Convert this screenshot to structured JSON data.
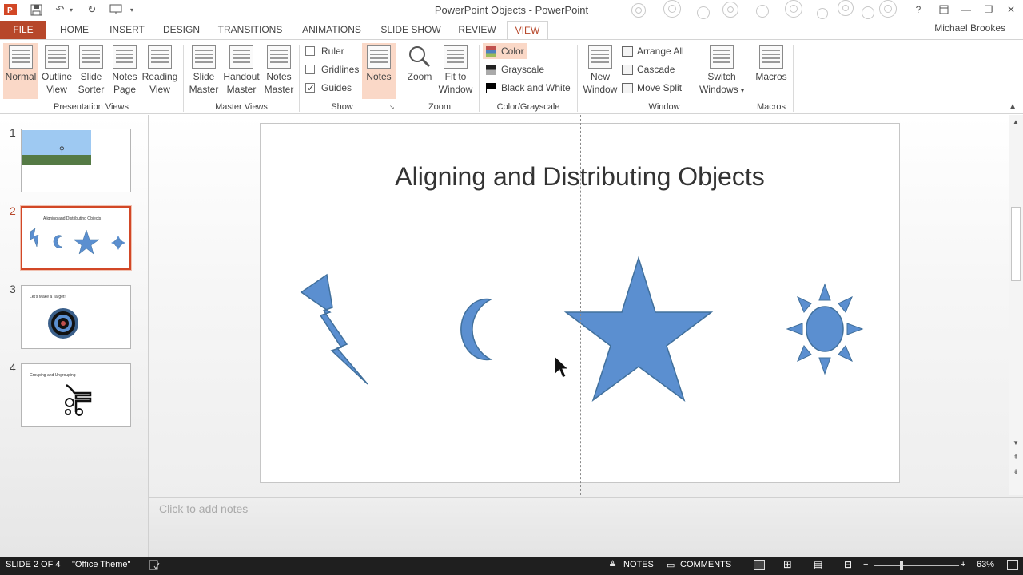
{
  "titlebar": {
    "app_title": "PowerPoint Objects - PowerPoint",
    "help": "?",
    "minimize": "—",
    "restore": "❐",
    "close": "✕"
  },
  "tabs": {
    "file": "FILE",
    "home": "HOME",
    "insert": "INSERT",
    "design": "DESIGN",
    "transitions": "TRANSITIONS",
    "animations": "ANIMATIONS",
    "slideshow": "SLIDE SHOW",
    "review": "REVIEW",
    "view": "VIEW",
    "user": "Michael Brookes"
  },
  "ribbon": {
    "presentation_views": {
      "label": "Presentation Views",
      "normal": "Normal",
      "outline": "Outline View",
      "sorter": "Slide Sorter",
      "notes_page": "Notes Page",
      "reading": "Reading View"
    },
    "master_views": {
      "label": "Master Views",
      "slide": "Slide Master",
      "handout": "Handout Master",
      "notes": "Notes Master"
    },
    "show": {
      "label": "Show",
      "ruler": "Ruler",
      "gridlines": "Gridlines",
      "guides": "Guides",
      "notes": "Notes",
      "ruler_checked": false,
      "gridlines_checked": false,
      "guides_checked": true
    },
    "zoom": {
      "label": "Zoom",
      "zoom": "Zoom",
      "fit": "Fit to Window"
    },
    "color": {
      "label": "Color/Grayscale",
      "color": "Color",
      "grayscale": "Grayscale",
      "bw": "Black and White"
    },
    "window": {
      "label": "Window",
      "new_window": "New Window",
      "arrange_all": "Arrange All",
      "cascade": "Cascade",
      "move_split": "Move Split",
      "switch": "Switch Windows"
    },
    "macros": {
      "label": "Macros",
      "macros": "Macros"
    }
  },
  "thumbnails": [
    {
      "num": "1",
      "title": ""
    },
    {
      "num": "2",
      "title": "Aligning and Distributing Objects"
    },
    {
      "num": "3",
      "title": "Let's Make a Target!"
    },
    {
      "num": "4",
      "title": "Grouping and Ungrouping"
    }
  ],
  "slide": {
    "title": "Aligning and Distributing Objects"
  },
  "notes": {
    "placeholder": "Click to add notes"
  },
  "status": {
    "slide_info": "SLIDE 2 OF 4",
    "theme": "\"Office Theme\"",
    "notes": "NOTES",
    "comments": "COMMENTS",
    "zoom": "63%"
  },
  "colors": {
    "accent": "#b7472a",
    "shape_fill": "#5b8fd0",
    "shape_stroke": "#41709c"
  }
}
